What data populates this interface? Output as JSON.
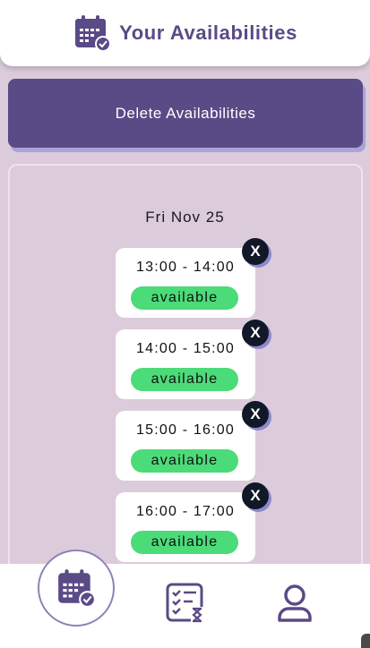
{
  "header": {
    "title": "Your Availabilities",
    "icon": "calendar-check-icon"
  },
  "actions": {
    "delete_label": "Delete Availabilities"
  },
  "day": {
    "date": "Fri Nov 25",
    "slots": [
      {
        "time": "13:00 - 14:00",
        "status": "available",
        "remove_label": "X"
      },
      {
        "time": "14:00 - 15:00",
        "status": "available",
        "remove_label": "X"
      },
      {
        "time": "15:00 - 16:00",
        "status": "available",
        "remove_label": "X"
      },
      {
        "time": "16:00 - 17:00",
        "status": "available",
        "remove_label": "X"
      }
    ]
  },
  "nav": {
    "items": [
      {
        "icon": "calendar-check-icon",
        "active": true
      },
      {
        "icon": "checklist-hourglass-icon",
        "active": false
      },
      {
        "icon": "user-icon",
        "active": false
      }
    ]
  },
  "colors": {
    "primary": "#5a4a86",
    "background": "#dccbdb",
    "status_available": "#4cdb79",
    "remove_button": "#111827"
  }
}
